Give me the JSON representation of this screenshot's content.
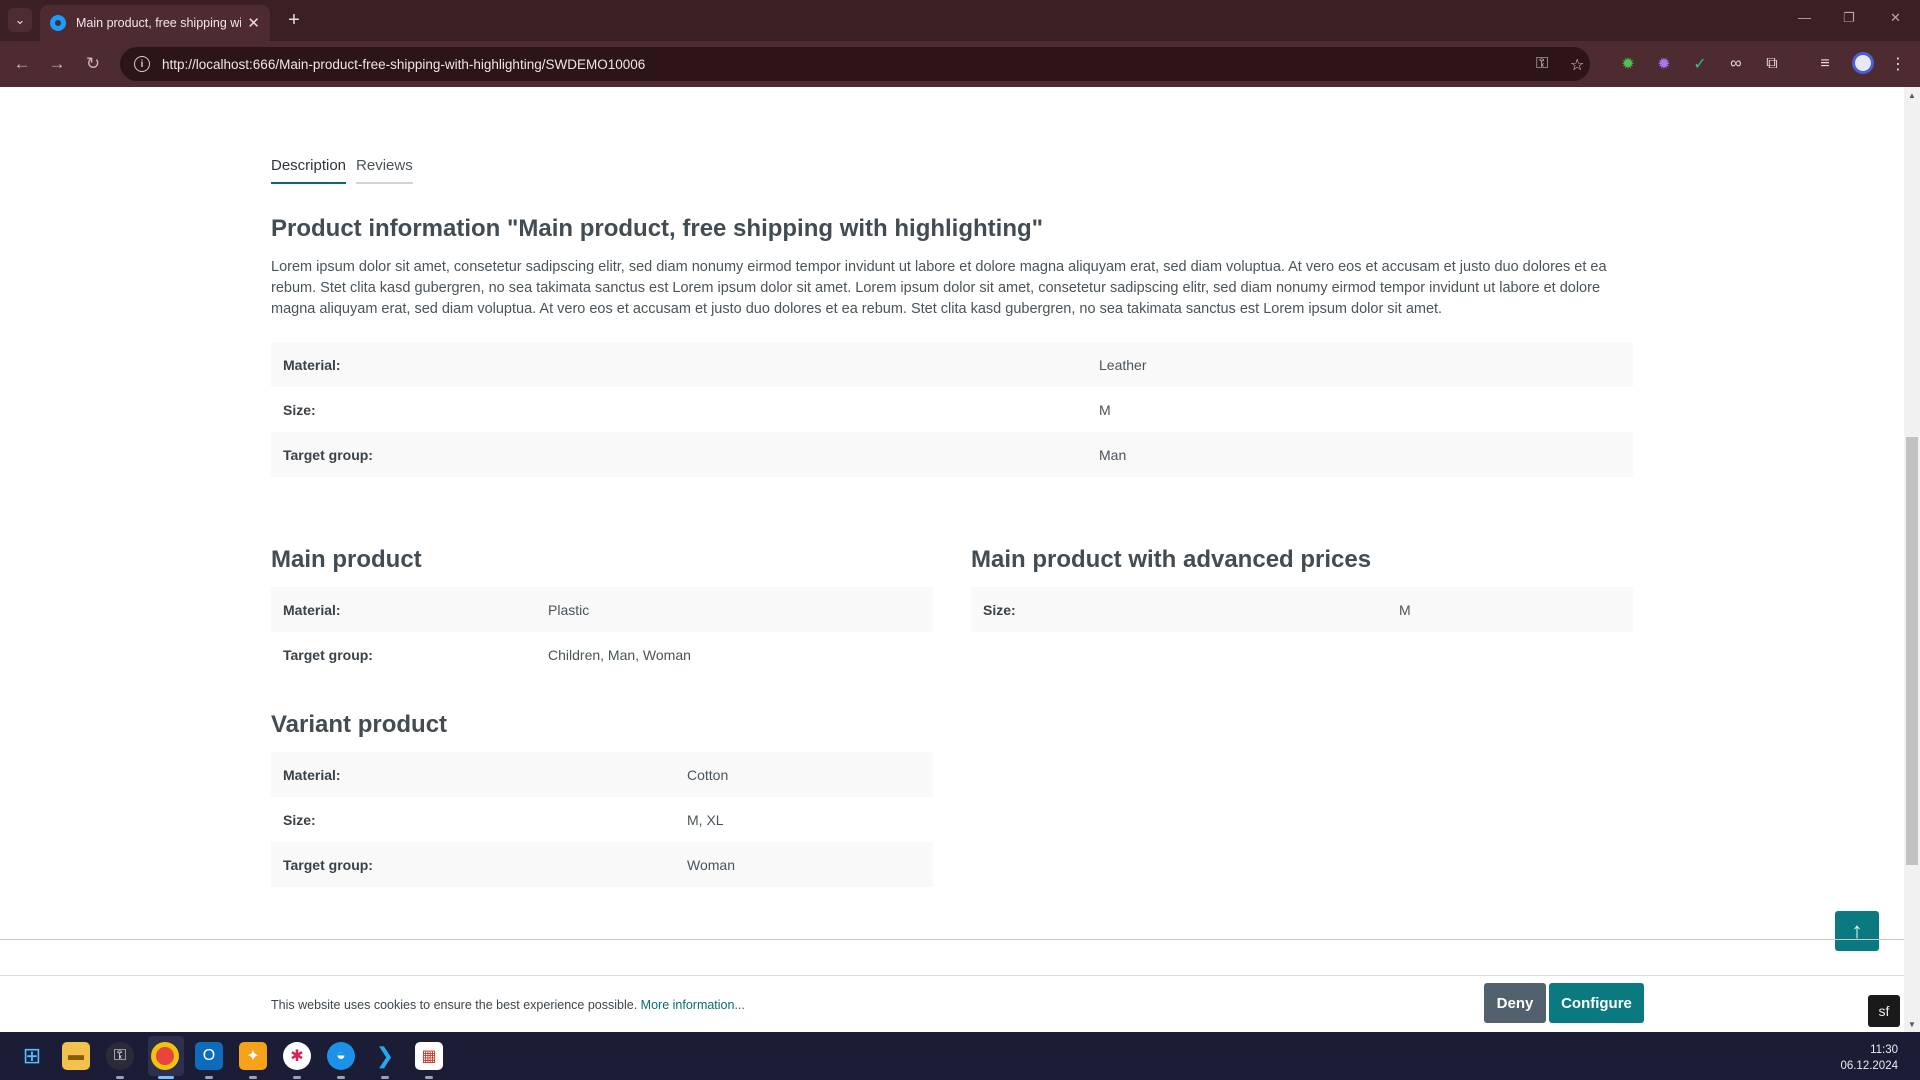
{
  "browser": {
    "tab_title": "Main product, free shipping with highlighting",
    "tab_close": "✕",
    "new_tab": "+",
    "url": "http://localhost:666/Main-product-free-shipping-with-highlighting/SWDEMO10006"
  },
  "product_tabs": [
    "Description",
    "Reviews"
  ],
  "description": {
    "heading": "Product information \"Main product, free shipping with highlighting\"",
    "text": "Lorem ipsum dolor sit amet, consetetur sadipscing elitr, sed diam nonumy eirmod tempor invidunt ut labore et dolore magna aliquyam erat, sed diam voluptua. At vero eos et accusam et justo duo dolores et ea rebum. Stet clita kasd gubergren, no sea takimata sanctus est Lorem ipsum dolor sit amet. Lorem ipsum dolor sit amet, consetetur sadipscing elitr, sed diam nonumy eirmod tempor invidunt ut labore et dolore magna aliquyam erat, sed diam voluptua. At vero eos et accusam et justo duo dolores et ea rebum. Stet clita kasd gubergren, no sea takimata sanctus est Lorem ipsum dolor sit amet.",
    "properties": [
      {
        "label": "Material:",
        "value": "Leather"
      },
      {
        "label": "Size:",
        "value": "M"
      },
      {
        "label": "Target group:",
        "value": "Man"
      }
    ]
  },
  "cross_selling": {
    "main_product": {
      "title": "Main product",
      "properties": [
        {
          "label": "Material:",
          "value": "Plastic"
        },
        {
          "label": "Target group:",
          "value": "Children, Man, Woman"
        }
      ]
    },
    "advanced_prices": {
      "title": "Main product with advanced prices",
      "properties": [
        {
          "label": "Size:",
          "value": "M"
        }
      ]
    },
    "variant_product": {
      "title": "Variant product",
      "properties": [
        {
          "label": "Material:",
          "value": "Cotton"
        },
        {
          "label": "Size:",
          "value": "M, XL"
        },
        {
          "label": "Target group:",
          "value": "Woman"
        }
      ]
    }
  },
  "cookie": {
    "text": "This website uses cookies to ensure the best experience possible.",
    "link": "More information...",
    "deny": "Deny",
    "configure": "Configure"
  },
  "taskbar": {
    "time": "11:30",
    "date": "06.12.2024"
  },
  "colors": {
    "accent": "#0b7a80",
    "deny_button": "#52616d",
    "browser_frame": "#4e2a31"
  }
}
